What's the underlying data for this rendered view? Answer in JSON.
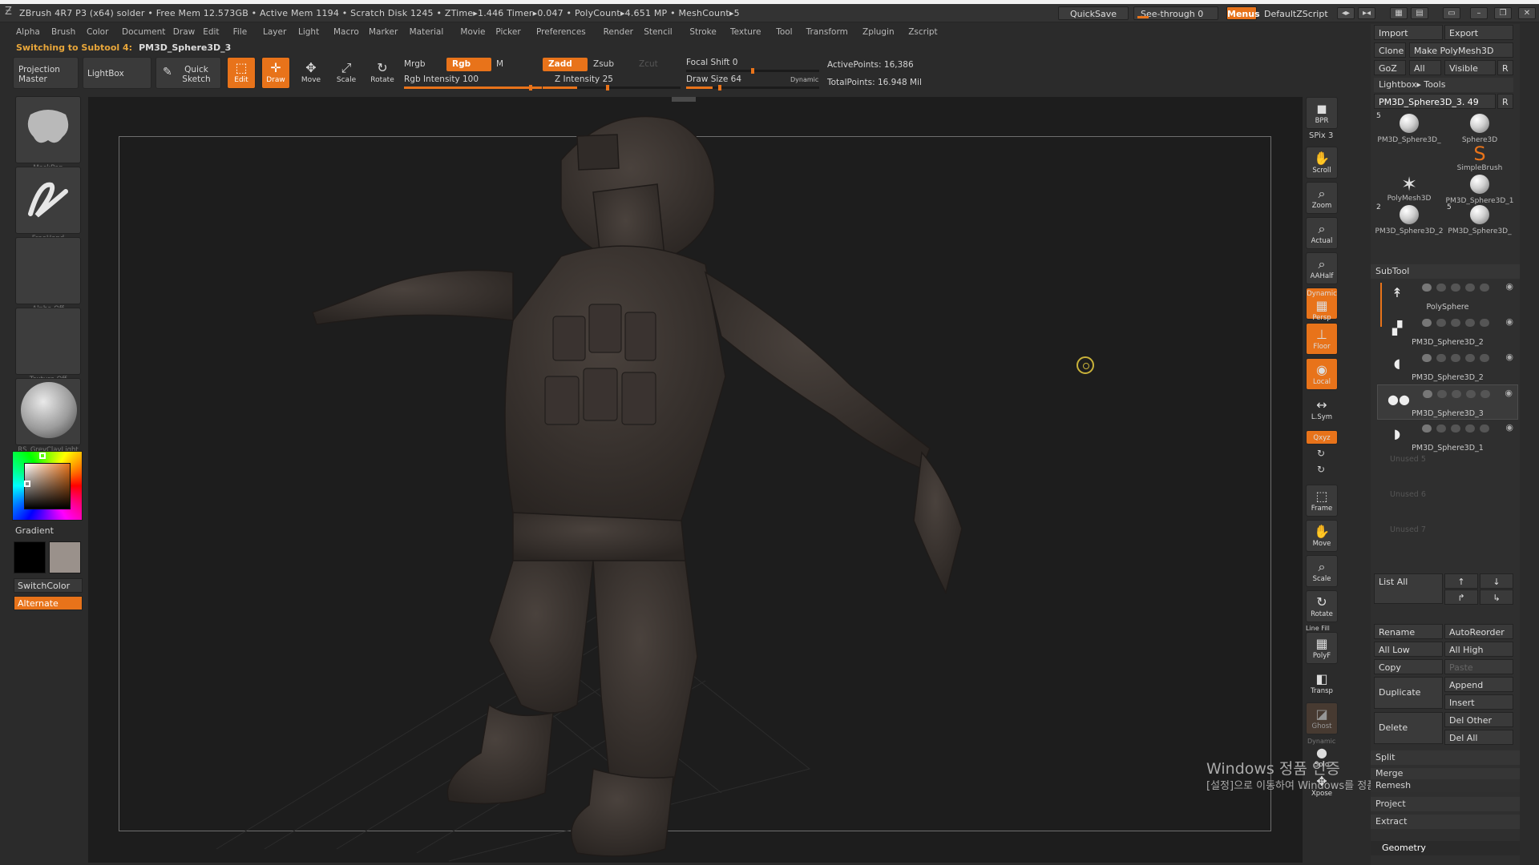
{
  "titlebar": {
    "text": "ZBrush 4R7 P3 (x64)    solder    • Free Mem 12.573GB • Active Mem 1194 • Scratch Disk 1245 •  ZTime▸1.446 Timer▸0.047 • PolyCount▸4.651  MP  • MeshCount▸5",
    "quicksave": "QuickSave",
    "seethrough": "See-through  0",
    "menus": "Menus",
    "default_script": "DefaultZScript"
  },
  "menubar": [
    "Alpha",
    "Brush",
    "Color",
    "Document",
    "Draw",
    "Edit",
    "File",
    "Layer",
    "Light",
    "Macro",
    "Marker",
    "Material",
    "Movie",
    "Picker",
    "Preferences",
    "Render",
    "Stencil",
    "Stroke",
    "Texture",
    "Tool",
    "Transform",
    "Zplugin",
    "Zscript"
  ],
  "status": {
    "label": "Switching to Subtool 4:",
    "value": "PM3D_Sphere3D_3"
  },
  "shelf": {
    "projection_master": "Projection Master",
    "lightbox": "LightBox",
    "quick_sketch": "Quick Sketch",
    "edit": "Edit",
    "draw": "Draw",
    "move": "Move",
    "scale": "Scale",
    "rotate": "Rotate",
    "mrgb": "Mrgb",
    "rgb": "Rgb",
    "m": "M",
    "rgb_intensity": "Rgb  Intensity 100",
    "zadd": "Zadd",
    "zsub": "Zsub",
    "zcut": "Zcut",
    "z_intensity": "Z Intensity 25",
    "focal_shift": "Focal  Shift 0",
    "draw_size": "Draw  Size 64",
    "dynamic": "Dynamic",
    "active_points": "ActivePoints: 16,386",
    "total_points": "TotalPoints: 16.948  Mil"
  },
  "left": {
    "brush_caption": "MaskPen",
    "stroke_caption": "FreeHand",
    "alpha_caption": "Alpha  Off",
    "texture_caption": "Texture  Off",
    "material_caption": "RS_GreyClayLight",
    "gradient": "Gradient",
    "switch_color": "SwitchColor",
    "alternate": "Alternate",
    "main_color": "#000000",
    "secondary_color": "#9a918b"
  },
  "righttray": {
    "bpr": "BPR",
    "spix": "SPix 3",
    "scroll": "Scroll",
    "zoom": "Zoom",
    "actual": "Actual",
    "aahalf": "AAHalf",
    "dynamic": "Dynamic",
    "persp": "Persp",
    "floor": "Floor",
    "local": "Local",
    "lsym": "L.Sym",
    "xyz": "Qxyz",
    "frame": "Frame",
    "move": "Move",
    "scale": "Scale",
    "rotate": "Rotate",
    "linefill": "Line Fill",
    "polyf": "PolyF",
    "transp": "Transp",
    "ghost": "Ghost",
    "dynamic2": "Dynamic",
    "solo": "Solo",
    "xpose": "Xpose"
  },
  "watermark": {
    "line1": "Windows 정품 인증",
    "line2": "[설정]으로 이동하여 Windows를 정품 인증합니다."
  },
  "tool_panel": {
    "import": "Import",
    "export": "Export",
    "clone": "Clone",
    "make_polymesh": "Make PolyMesh3D",
    "goz": "GoZ",
    "all": "All",
    "visible": "Visible",
    "r": "R",
    "lightbox_tools": "Lightbox▸ Tools",
    "current_tool": "PM3D_Sphere3D_3. 49",
    "r2": "R",
    "tools": [
      {
        "name": "PM3D_Sphere3D_",
        "count": "5"
      },
      {
        "name": "Sphere3D",
        "count": ""
      },
      {
        "name": "SimpleBrush",
        "count": ""
      },
      {
        "name": "PolyMesh3D",
        "count": ""
      },
      {
        "name": "PM3D_Sphere3D_1",
        "count": ""
      },
      {
        "name": "PM3D_Sphere3D_2",
        "count": "2"
      },
      {
        "name": "PM3D_Sphere3D_",
        "count": "5"
      }
    ],
    "subtool_header": "SubTool",
    "subtools": [
      "PolySphere",
      "PM3D_Sphere3D_2",
      "PM3D_Sphere3D_2",
      "PM3D_Sphere3D_3",
      "PM3D_Sphere3D_1"
    ],
    "unused": [
      "Unused  5",
      "Unused  6",
      "Unused  7"
    ],
    "list_all": "List  All",
    "rename": "Rename",
    "autoreorder": "AutoReorder",
    "all_low": "All  Low",
    "all_high": "All  High",
    "copy": "Copy",
    "paste": "Paste",
    "duplicate": "Duplicate",
    "append": "Append",
    "insert": "Insert",
    "delete": "Delete",
    "del_other": "Del  Other",
    "del_all": "Del  All",
    "split": "Split",
    "merge": "Merge",
    "remesh": "Remesh",
    "project": "Project",
    "extract": "Extract",
    "geometry": "Geometry"
  },
  "colors": {
    "accent": "#e8731a",
    "panel": "#2f2f2f",
    "canvas": "#1d1d1d"
  }
}
